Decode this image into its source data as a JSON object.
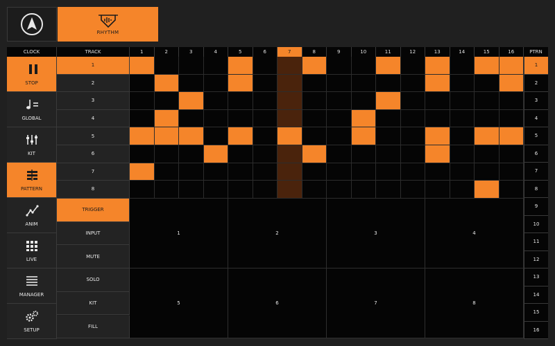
{
  "header": {
    "rhythm_tab": "RHYTHM",
    "clock": "CLOCK",
    "track": "TRACK",
    "ptrn": "PTRN"
  },
  "steps": [
    "1",
    "2",
    "3",
    "4",
    "5",
    "6",
    "7",
    "8",
    "9",
    "10",
    "11",
    "12",
    "13",
    "14",
    "15",
    "16"
  ],
  "active_step": 7,
  "nav": [
    {
      "label": "STOP",
      "icon": "pause-icon",
      "active": true
    },
    {
      "label": "GLOBAL",
      "icon": "tempo-icon",
      "active": false
    },
    {
      "label": "KIT",
      "icon": "sliders-icon",
      "active": false
    },
    {
      "label": "PATTERN",
      "icon": "pattern-icon",
      "active": true
    },
    {
      "label": "ANIM",
      "icon": "anim-icon",
      "active": false
    },
    {
      "label": "LIVE",
      "icon": "grid-icon",
      "active": false
    },
    {
      "label": "MANAGER",
      "icon": "list-icon",
      "active": false
    },
    {
      "label": "SETUP",
      "icon": "gears-icon",
      "active": false
    }
  ],
  "tracks": [
    "1",
    "2",
    "3",
    "4",
    "5",
    "6",
    "7",
    "8"
  ],
  "active_track": 0,
  "grid": [
    [
      1,
      0,
      0,
      0,
      1,
      0,
      0,
      1,
      0,
      0,
      1,
      0,
      1,
      0,
      1,
      1
    ],
    [
      0,
      1,
      0,
      0,
      1,
      0,
      0,
      0,
      0,
      0,
      0,
      0,
      1,
      0,
      0,
      1
    ],
    [
      0,
      0,
      1,
      0,
      0,
      0,
      0,
      0,
      0,
      0,
      1,
      0,
      0,
      0,
      0,
      0
    ],
    [
      0,
      1,
      0,
      0,
      0,
      0,
      0,
      0,
      0,
      1,
      0,
      0,
      0,
      0,
      0,
      0
    ],
    [
      1,
      1,
      1,
      0,
      1,
      0,
      1,
      0,
      0,
      1,
      0,
      0,
      1,
      0,
      1,
      1
    ],
    [
      0,
      0,
      0,
      1,
      0,
      0,
      0,
      1,
      0,
      0,
      0,
      0,
      1,
      0,
      0,
      0
    ],
    [
      1,
      0,
      0,
      0,
      0,
      0,
      0,
      0,
      0,
      0,
      0,
      0,
      0,
      0,
      0,
      0
    ],
    [
      0,
      0,
      0,
      0,
      0,
      0,
      0,
      0,
      0,
      0,
      0,
      0,
      0,
      0,
      1,
      0
    ]
  ],
  "patterns": [
    "1",
    "2",
    "3",
    "4",
    "5",
    "6",
    "7",
    "8",
    "9",
    "10",
    "11",
    "12",
    "13",
    "14",
    "15",
    "16"
  ],
  "active_pattern": 0,
  "modes": [
    {
      "label": "TRIGGER",
      "active": true
    },
    {
      "label": "INPUT",
      "active": false
    },
    {
      "label": "MUTE",
      "active": false
    },
    {
      "label": "SOLO",
      "active": false
    },
    {
      "label": "KIT",
      "active": false
    },
    {
      "label": "FILL",
      "active": false
    }
  ],
  "pads": [
    "1",
    "2",
    "3",
    "4",
    "5",
    "6",
    "7",
    "8"
  ],
  "colors": {
    "accent": "#f5852a",
    "step_highlight": "#4a230c",
    "cell": "#050505",
    "panel": "#232323"
  }
}
